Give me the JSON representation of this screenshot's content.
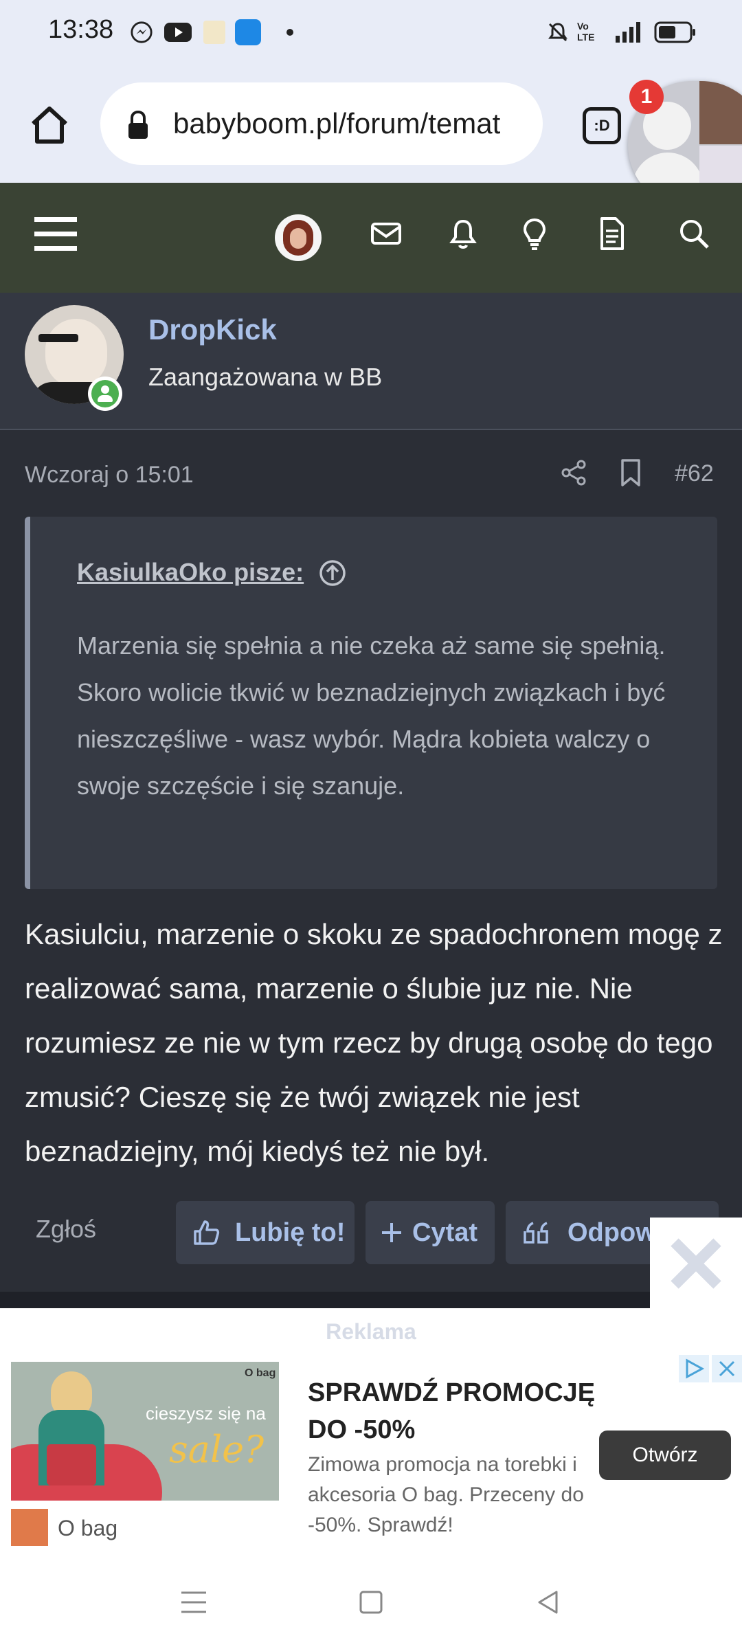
{
  "status_bar": {
    "time": "13:38"
  },
  "browser": {
    "url": "babyboom.pl/forum/temat",
    "tabs_label": ":D",
    "notification_count": "1"
  },
  "post": {
    "author": "DropKick",
    "author_title": "Zaangażowana w BB",
    "date": "Wczoraj o 15:01",
    "number": "#62",
    "quote_author": "KasiulkaOko pisze:",
    "quote_text": "Marzenia się spełnia a nie czeka aż same się spełnią. Skoro wolicie tkwić w beznadziejnych związkach i być nieszczęśliwe - wasz wybór. Mądra kobieta walczy o swoje szczęście i się szanuje.",
    "body": "Kasiulciu, marzenie o skoku ze spadochronem mogę z realizować sama, marzenie o ślubie juz nie. Nie rozumiesz ze nie w tym rzecz by drugą osobę do tego zmusić? Cieszę się że twój związek nie jest beznadziejny, mój kiedyś też nie był.",
    "report_label": "Zgłoś",
    "like_label": "Lubię to!",
    "quote_label": "Cytat",
    "reply_label": "Odpow"
  },
  "ad": {
    "label": "Reklama",
    "image_brand": "O bag",
    "image_line1": "cieszysz się na",
    "image_line2": "sale?",
    "headline": "SPRAWDŹ PROMOCJĘ DO -50%",
    "description": "Zimowa promocja na torebki i akcesoria O bag. Przeceny do -50%. Sprawdź!",
    "button": "Otwórz",
    "brand": "O bag"
  },
  "colors": {
    "forum_header": "#3a4334",
    "page_bg": "#2b2e36",
    "link": "#a9c0e8",
    "online_green": "#4caf50"
  }
}
